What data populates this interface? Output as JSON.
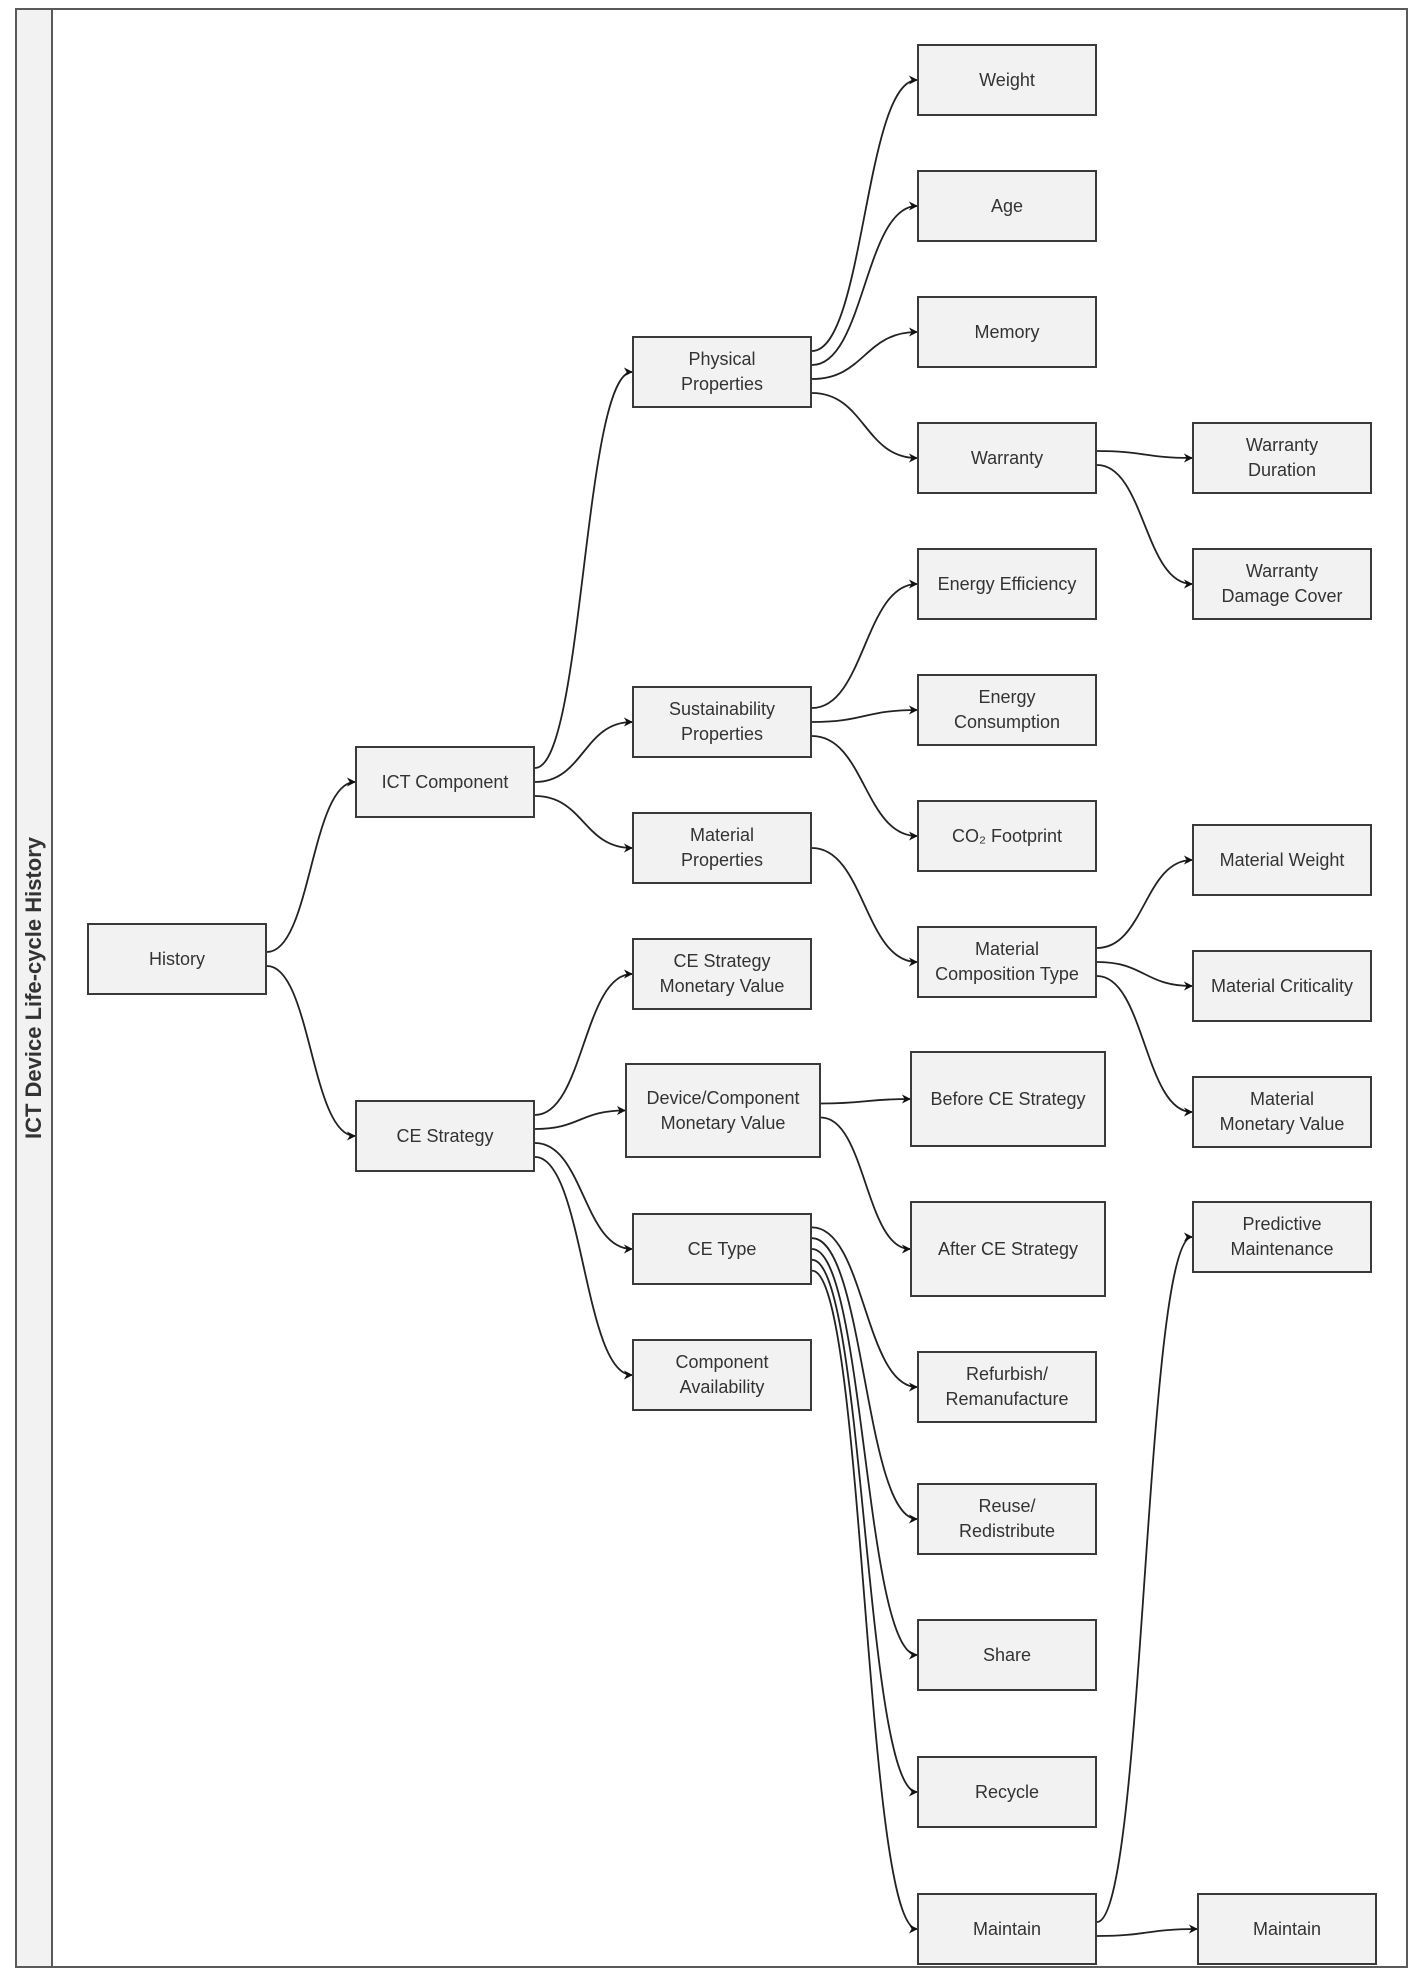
{
  "title": "ICT Device Life-cycle History",
  "colors": {
    "node_fill": "#f2f2f2",
    "node_border": "#3a3a3a",
    "text": "#333333",
    "edge": "#222222"
  },
  "nodes": [
    {
      "id": "history",
      "label": "History"
    },
    {
      "id": "ict-component",
      "label": "ICT Component"
    },
    {
      "id": "ce-strategy",
      "label": "CE Strategy"
    },
    {
      "id": "physical-properties",
      "label": "Physical\nProperties"
    },
    {
      "id": "sustainability-properties",
      "label": "Sustainability\nProperties"
    },
    {
      "id": "material-properties",
      "label": "Material\nProperties"
    },
    {
      "id": "ce-strategy-monetary-value",
      "label": "CE Strategy\nMonetary Value"
    },
    {
      "id": "device-component-monetary-value",
      "label": "Device/Component\nMonetary Value"
    },
    {
      "id": "ce-type",
      "label": "CE Type"
    },
    {
      "id": "component-availability",
      "label": "Component\nAvailability"
    },
    {
      "id": "weight",
      "label": "Weight"
    },
    {
      "id": "age",
      "label": "Age"
    },
    {
      "id": "memory",
      "label": "Memory"
    },
    {
      "id": "warranty",
      "label": "Warranty"
    },
    {
      "id": "energy-efficiency",
      "label": "Energy Efficiency"
    },
    {
      "id": "energy-consumption",
      "label": "Energy\nConsumption"
    },
    {
      "id": "co2-footprint",
      "label": "CO₂  Footprint"
    },
    {
      "id": "material-composition-type",
      "label": "Material\nComposition Type"
    },
    {
      "id": "before-ce-strategy",
      "label": "Before CE Strategy"
    },
    {
      "id": "after-ce-strategy",
      "label": "After CE Strategy"
    },
    {
      "id": "refurbish-remanufacture",
      "label": "Refurbish/\nRemanufacture"
    },
    {
      "id": "reuse-redistribute",
      "label": "Reuse/\nRedistribute"
    },
    {
      "id": "share",
      "label": "Share"
    },
    {
      "id": "recycle",
      "label": "Recycle"
    },
    {
      "id": "maintain",
      "label": "Maintain"
    },
    {
      "id": "warranty-duration",
      "label": "Warranty\nDuration"
    },
    {
      "id": "warranty-damage-cover",
      "label": "Warranty\nDamage Cover"
    },
    {
      "id": "material-weight",
      "label": "Material Weight"
    },
    {
      "id": "material-criticality",
      "label": "Material Criticality"
    },
    {
      "id": "material-monetary-value",
      "label": "Material\nMonetary Value"
    },
    {
      "id": "predictive-maintenance",
      "label": "Predictive\nMaintenance"
    },
    {
      "id": "maintain-2",
      "label": "Maintain"
    }
  ],
  "edges": [
    [
      "history",
      "ict-component"
    ],
    [
      "history",
      "ce-strategy"
    ],
    [
      "ict-component",
      "physical-properties"
    ],
    [
      "ict-component",
      "sustainability-properties"
    ],
    [
      "ict-component",
      "material-properties"
    ],
    [
      "ce-strategy",
      "ce-strategy-monetary-value"
    ],
    [
      "ce-strategy",
      "device-component-monetary-value"
    ],
    [
      "ce-strategy",
      "ce-type"
    ],
    [
      "ce-strategy",
      "component-availability"
    ],
    [
      "physical-properties",
      "weight"
    ],
    [
      "physical-properties",
      "age"
    ],
    [
      "physical-properties",
      "memory"
    ],
    [
      "physical-properties",
      "warranty"
    ],
    [
      "warranty",
      "warranty-duration"
    ],
    [
      "warranty",
      "warranty-damage-cover"
    ],
    [
      "sustainability-properties",
      "energy-efficiency"
    ],
    [
      "sustainability-properties",
      "energy-consumption"
    ],
    [
      "sustainability-properties",
      "co2-footprint"
    ],
    [
      "material-properties",
      "material-composition-type"
    ],
    [
      "material-composition-type",
      "material-weight"
    ],
    [
      "material-composition-type",
      "material-criticality"
    ],
    [
      "material-composition-type",
      "material-monetary-value"
    ],
    [
      "device-component-monetary-value",
      "before-ce-strategy"
    ],
    [
      "device-component-monetary-value",
      "after-ce-strategy"
    ],
    [
      "ce-type",
      "refurbish-remanufacture"
    ],
    [
      "ce-type",
      "reuse-redistribute"
    ],
    [
      "ce-type",
      "share"
    ],
    [
      "ce-type",
      "recycle"
    ],
    [
      "ce-type",
      "maintain"
    ],
    [
      "maintain",
      "predictive-maintenance"
    ],
    [
      "maintain",
      "maintain-2"
    ]
  ]
}
